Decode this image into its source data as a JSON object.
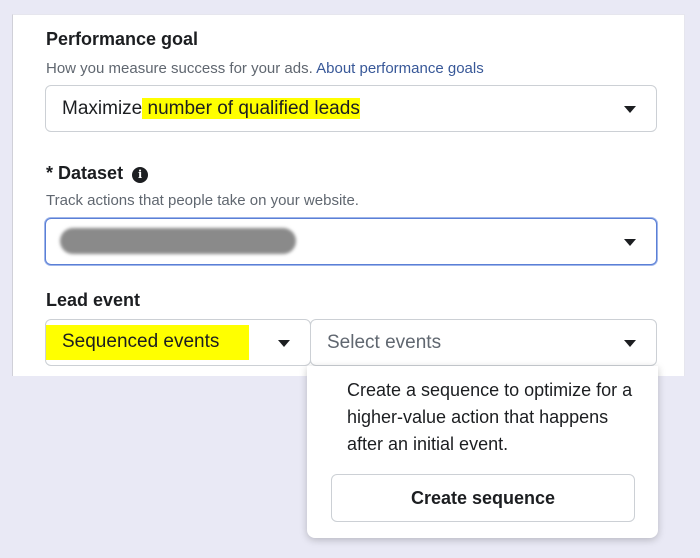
{
  "performance_goal": {
    "title": "Performance goal",
    "description": "How you measure success for your ads.",
    "link": "About performance goals",
    "selected_prefix": "Maximize",
    "selected_highlight": " number of qualified leads"
  },
  "dataset": {
    "required_marker": "*",
    "title": "Dataset",
    "info_icon": "info-icon",
    "description": "Track actions that people take on your website."
  },
  "lead_event": {
    "title": "Lead event",
    "type_value": "Sequenced events",
    "events_placeholder": "Select events"
  },
  "popover": {
    "text": "Create a sequence to optimize for a higher-value action that happens after an initial event.",
    "button_label": "Create sequence"
  },
  "colors": {
    "highlight": "#ffff00",
    "link": "#385898",
    "focus_border": "#5b7fd6"
  }
}
